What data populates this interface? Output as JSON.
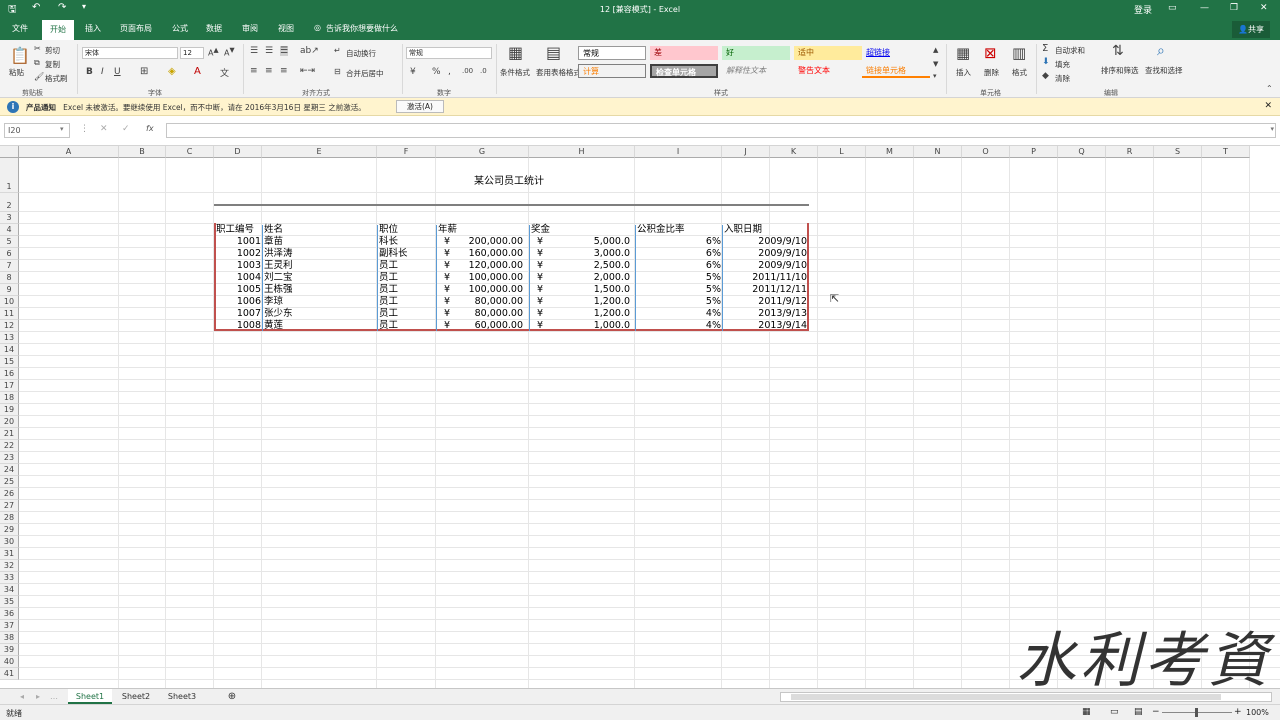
{
  "titlebar": {
    "title": "12 [兼容模式] - Excel",
    "login": "登录"
  },
  "tabs": [
    "文件",
    "开始",
    "插入",
    "页面布局",
    "公式",
    "数据",
    "审阅",
    "视图"
  ],
  "tell_me": "告诉我你想要做什么",
  "share": "共享",
  "ribbon": {
    "paste": "粘贴",
    "cut": "剪切",
    "copy": "复制",
    "format_painter": "格式刷",
    "clipboard_label": "剪贴板",
    "font_name": "宋体",
    "font_size": "12",
    "font_label": "字体",
    "wrap_text": "自动换行",
    "merge_center": "合并后居中",
    "align_label": "对齐方式",
    "number_format": "常规",
    "number_label": "数字",
    "cond_format": "条件格式",
    "table_format": "套用表格格式",
    "styles": [
      "常规",
      "差",
      "好",
      "适中",
      "超链接",
      "计算",
      "检查单元格",
      "解释性文本",
      "警告文本",
      "链接单元格"
    ],
    "styles_label": "样式",
    "insert": "插入",
    "delete": "删除",
    "format": "格式",
    "cells_label": "单元格",
    "autosum": "自动求和",
    "fill": "填充",
    "clear": "清除",
    "sort_filter": "排序和筛选",
    "find_select": "查找和选择",
    "editing_label": "编辑"
  },
  "notice": {
    "title": "产品通知",
    "text": "Excel 未被激活。要继续使用 Excel，而不中断，请在 2016年3月16日 星期三 之前激活。",
    "button": "激活(A)"
  },
  "formula_bar": {
    "name_box": "I20",
    "fx": "fx",
    "value": ""
  },
  "columns": [
    "A",
    "B",
    "C",
    "D",
    "E",
    "F",
    "G",
    "H",
    "I",
    "J",
    "K",
    "L",
    "M",
    "N",
    "O",
    "P",
    "Q",
    "R",
    "S",
    "T"
  ],
  "rows": [
    "1",
    "2",
    "3",
    "4",
    "5",
    "6",
    "7",
    "8",
    "9",
    "10",
    "11",
    "12",
    "13",
    "14",
    "15",
    "16",
    "17",
    "18",
    "19",
    "20",
    "21",
    "22",
    "23",
    "24",
    "25",
    "26",
    "27",
    "28",
    "29",
    "30",
    "31",
    "32",
    "33",
    "34",
    "35",
    "36",
    "37",
    "38",
    "39",
    "40",
    "41"
  ],
  "sheet": {
    "title": "某公司员工统计",
    "headers": [
      "职工编号",
      "姓名",
      "职位",
      "年薪",
      "奖金",
      "公积金比率",
      "入职日期"
    ],
    "rows": [
      [
        "1001",
        "章苗",
        "科长",
        "¥",
        "200,000.00",
        "¥",
        "5,000.0",
        "6%",
        "2009/9/10"
      ],
      [
        "1002",
        "洪泽涛",
        "副科长",
        "¥",
        "160,000.00",
        "¥",
        "3,000.0",
        "6%",
        "2009/9/10"
      ],
      [
        "1003",
        "王灵利",
        "员工",
        "¥",
        "120,000.00",
        "¥",
        "2,500.0",
        "6%",
        "2009/9/10"
      ],
      [
        "1004",
        "刘二宝",
        "员工",
        "¥",
        "100,000.00",
        "¥",
        "2,000.0",
        "5%",
        "2011/11/10"
      ],
      [
        "1005",
        "王栋强",
        "员工",
        "¥",
        "100,000.00",
        "¥",
        "1,500.0",
        "5%",
        "2011/12/11"
      ],
      [
        "1006",
        "李琼",
        "员工",
        "¥",
        "80,000.00",
        "¥",
        "1,200.0",
        "5%",
        "2011/9/12"
      ],
      [
        "1007",
        "张少东",
        "员工",
        "¥",
        "80,000.00",
        "¥",
        "1,200.0",
        "4%",
        "2013/9/13"
      ],
      [
        "1008",
        "黄莲",
        "员工",
        "¥",
        "60,000.00",
        "¥",
        "1,000.0",
        "4%",
        "2013/9/14"
      ]
    ]
  },
  "sheet_tabs": [
    "Sheet1",
    "Sheet2",
    "Sheet3"
  ],
  "status": {
    "ready": "就绪",
    "zoom": "100%"
  },
  "watermark": "水利考資"
}
